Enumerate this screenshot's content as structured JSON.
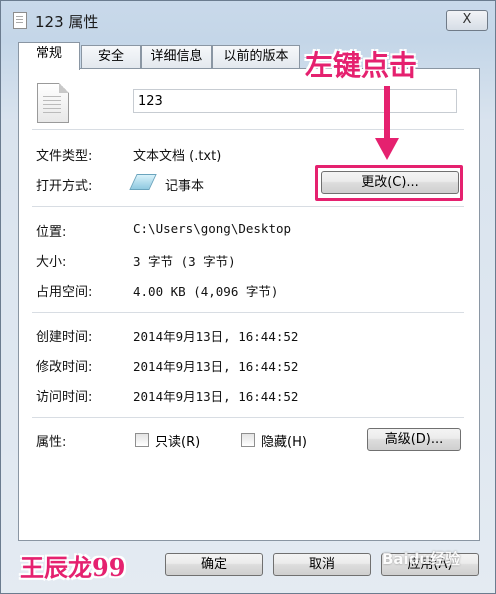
{
  "window": {
    "title": "123 属性",
    "close_label": "X"
  },
  "tabs": [
    "常规",
    "安全",
    "详细信息",
    "以前的版本"
  ],
  "general": {
    "file_name": "123",
    "file_type_label": "文件类型:",
    "file_type_value": "文本文档 (.txt)",
    "opens_with_label": "打开方式:",
    "opens_with_value": "记事本",
    "change_button": "更改(C)...",
    "location_label": "位置:",
    "location_value": "C:\\Users\\gong\\Desktop",
    "size_label": "大小:",
    "size_value": "3 字节 (3 字节)",
    "size_on_disk_label": "占用空间:",
    "size_on_disk_value": "4.00 KB (4,096 字节)",
    "created_label": "创建时间:",
    "created_value": "2014年9月13日, 16:44:52",
    "modified_label": "修改时间:",
    "modified_value": "2014年9月13日, 16:44:52",
    "accessed_label": "访问时间:",
    "accessed_value": "2014年9月13日, 16:44:52",
    "attributes_label": "属性:",
    "readonly_label": "只读(R)",
    "hidden_label": "隐藏(H)",
    "advanced_button": "高级(D)..."
  },
  "footer": {
    "ok_button": "确定",
    "cancel_button": "取消",
    "apply_button": "应用(A)"
  },
  "overlay": {
    "annotation_text": "左键点击",
    "author_watermark": "王辰龙99",
    "site_watermark": "Baidu经验",
    "accent_color": "#e5216f"
  }
}
